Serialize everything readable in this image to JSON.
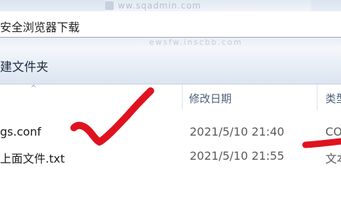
{
  "top_strip": {
    "blurred_text": "ww.sqadmin.com"
  },
  "address_bar": {
    "text": "安全浏览器下载"
  },
  "blur_row": {
    "text": "ewsfw.inscbb.com"
  },
  "toolbar": {
    "new_folder_label": "建文件夹"
  },
  "columns": {
    "sort_indicator": "^",
    "date_modified": "修改日期",
    "type": "类型"
  },
  "files": [
    {
      "name": "gs.conf",
      "date": "2021/5/10 21:40",
      "type": "CO"
    },
    {
      "name": "上面文件.txt",
      "date": "2021/5/10 21:55",
      "type": "文本"
    }
  ],
  "colors": {
    "annotation_red": "#e0121f",
    "header_text": "#4c607a",
    "toolbar_text": "#1c2d44"
  }
}
